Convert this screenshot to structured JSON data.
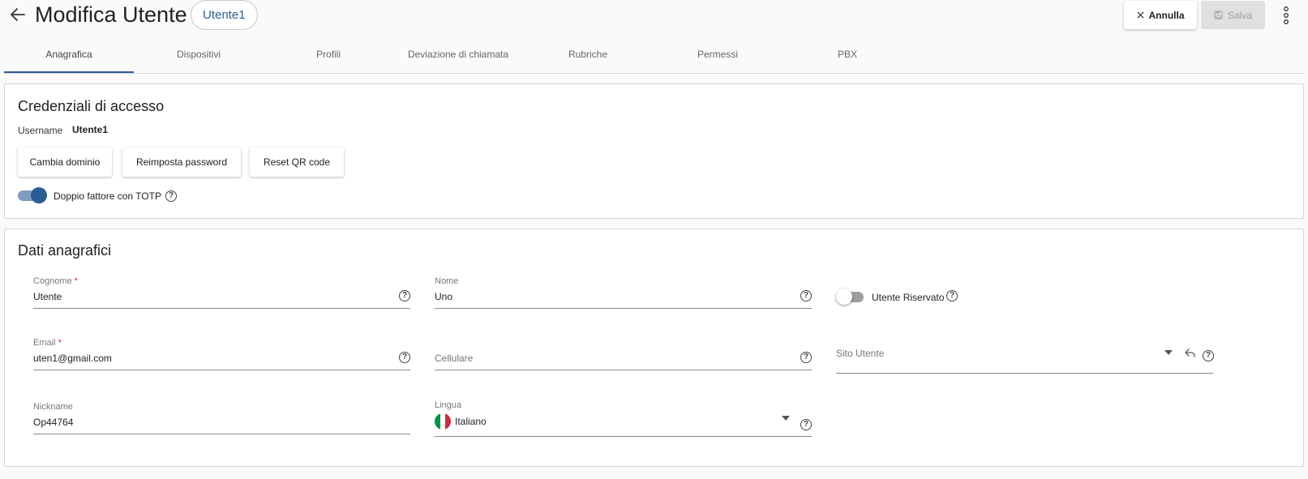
{
  "header": {
    "title": "Modifica Utente",
    "user_chip": "Utente1",
    "cancel_label": "Annulla",
    "save_label": "Salva",
    "icons": [
      "back-arrow-icon",
      "close-icon",
      "save-icon",
      "more-vert-icon"
    ]
  },
  "tabs": [
    {
      "label": "Anagrafica",
      "active": true
    },
    {
      "label": "Dispositivi",
      "active": false
    },
    {
      "label": "Profili",
      "active": false
    },
    {
      "label": "Deviazione di chiamata",
      "active": false
    },
    {
      "label": "Rubriche",
      "active": false
    },
    {
      "label": "Permessi",
      "active": false
    },
    {
      "label": "PBX",
      "active": false
    }
  ],
  "credentials": {
    "title": "Credenziali di accesso",
    "username_label": "Username",
    "username_value": "Utente1",
    "buttons": {
      "change_domain": "Cambia dominio",
      "reset_password": "Reimposta password",
      "reset_qr": "Reset QR code"
    },
    "totp_label": "Doppio fattore con TOTP",
    "totp_enabled": true
  },
  "personal": {
    "title": "Dati anagrafici",
    "required_mark": "*",
    "surname": {
      "label": "Cognome",
      "value": "Utente"
    },
    "name": {
      "label": "Nome",
      "value": "Uno"
    },
    "reserved": {
      "label": "Utente Riservato",
      "enabled": false
    },
    "email": {
      "label": "Email",
      "value": "uten1@gmail.com"
    },
    "mobile": {
      "placeholder": "Cellulare"
    },
    "site": {
      "placeholder": "Sito Utente"
    },
    "nickname": {
      "label": "Nickname",
      "value": "Op44764"
    },
    "language": {
      "label": "Lingua",
      "value": "Italiano",
      "flag_colors": [
        "#009246",
        "#ffffff",
        "#ce2b37"
      ]
    }
  },
  "colors": {
    "accent": "#2b5d92",
    "required": "#d32f2f"
  }
}
